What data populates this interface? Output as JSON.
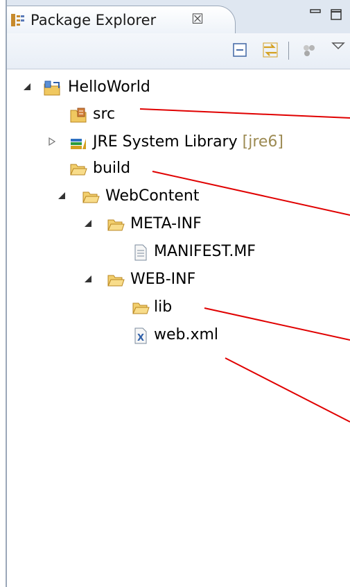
{
  "view": {
    "title": "Package Explorer",
    "close_glyph": "☒"
  },
  "tree": {
    "project": "HelloWorld",
    "src": "src",
    "jre": "JRE System Library",
    "jre_decor": "[jre6]",
    "build": "build",
    "webcontent": "WebContent",
    "metainf": "META-INF",
    "manifest": "MANIFEST.MF",
    "webinf": "WEB-INF",
    "lib": "lib",
    "webxml": "web.xml"
  },
  "icons": {
    "project": "java-project-icon",
    "source_folder": "source-folder-icon",
    "library": "library-icon",
    "folder": "folder-icon",
    "file": "text-file-icon",
    "xml": "xml-file-icon"
  },
  "colors": {
    "annotation_line": "#e00000",
    "folder": "#e8b24a",
    "decoration": "#9c8a52"
  }
}
